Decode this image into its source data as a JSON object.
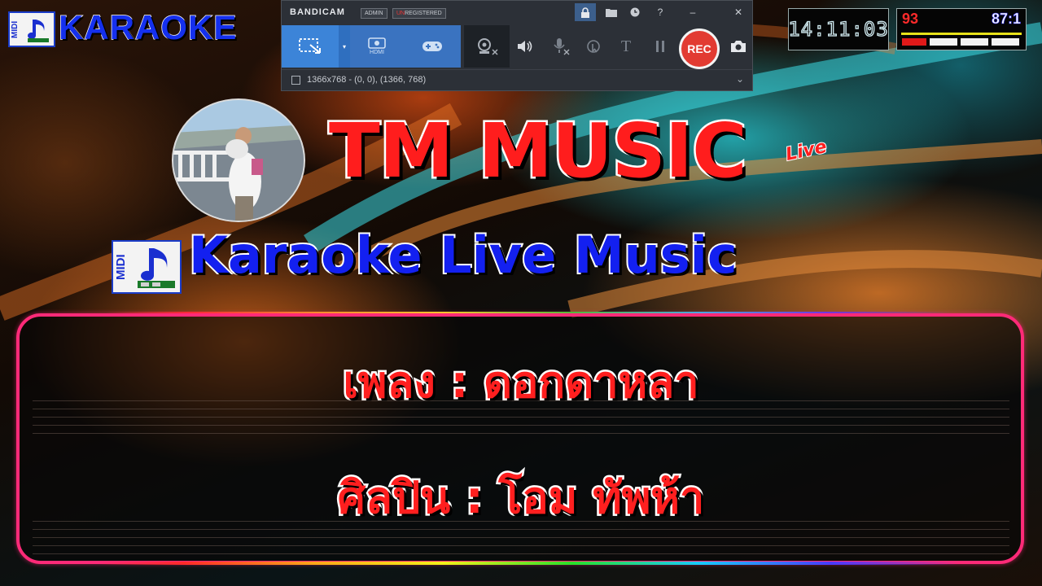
{
  "logo": {
    "midi_label": "MIDI",
    "karaoke_text": "KARAOKE"
  },
  "bandicam": {
    "brand": "BANDICAM",
    "tag_admin": "ADMIN",
    "tag_unregistered_prefix": "UN",
    "tag_unregistered_rest": "REGISTERED",
    "mode_hdmi_label": "HDMI",
    "rec_label": "REC",
    "resolution_text": "1366x768 - (0, 0), (1366, 768)"
  },
  "clock": {
    "time": "14:11:03"
  },
  "score": {
    "left": "93",
    "right": "87:1"
  },
  "header": {
    "title": "TM MUSIC",
    "title_badge": "Live",
    "subtitle": "Karaoke Live Music",
    "subtitle_midi_label": "MIDI"
  },
  "song": {
    "title_line": "เพลง : ดอกดาหลา",
    "artist_line": "ศิลปิน : โอม ทัพห้า"
  },
  "colors": {
    "accent_red": "#ff1d1d",
    "accent_blue": "#1320f0",
    "panel_border": "#ff2a78",
    "bandicam_rec": "#e23b32"
  },
  "icons": [
    "music-note-icon",
    "select-area-icon",
    "hdmi-icon",
    "gamepad-icon",
    "webcam-icon",
    "speaker-icon",
    "microphone-icon",
    "cursor-icon",
    "text-icon",
    "pause-icon",
    "camera-icon",
    "lock-icon",
    "folder-icon",
    "clock-icon",
    "help-icon",
    "minimize-icon",
    "close-icon",
    "chevron-down-icon"
  ]
}
